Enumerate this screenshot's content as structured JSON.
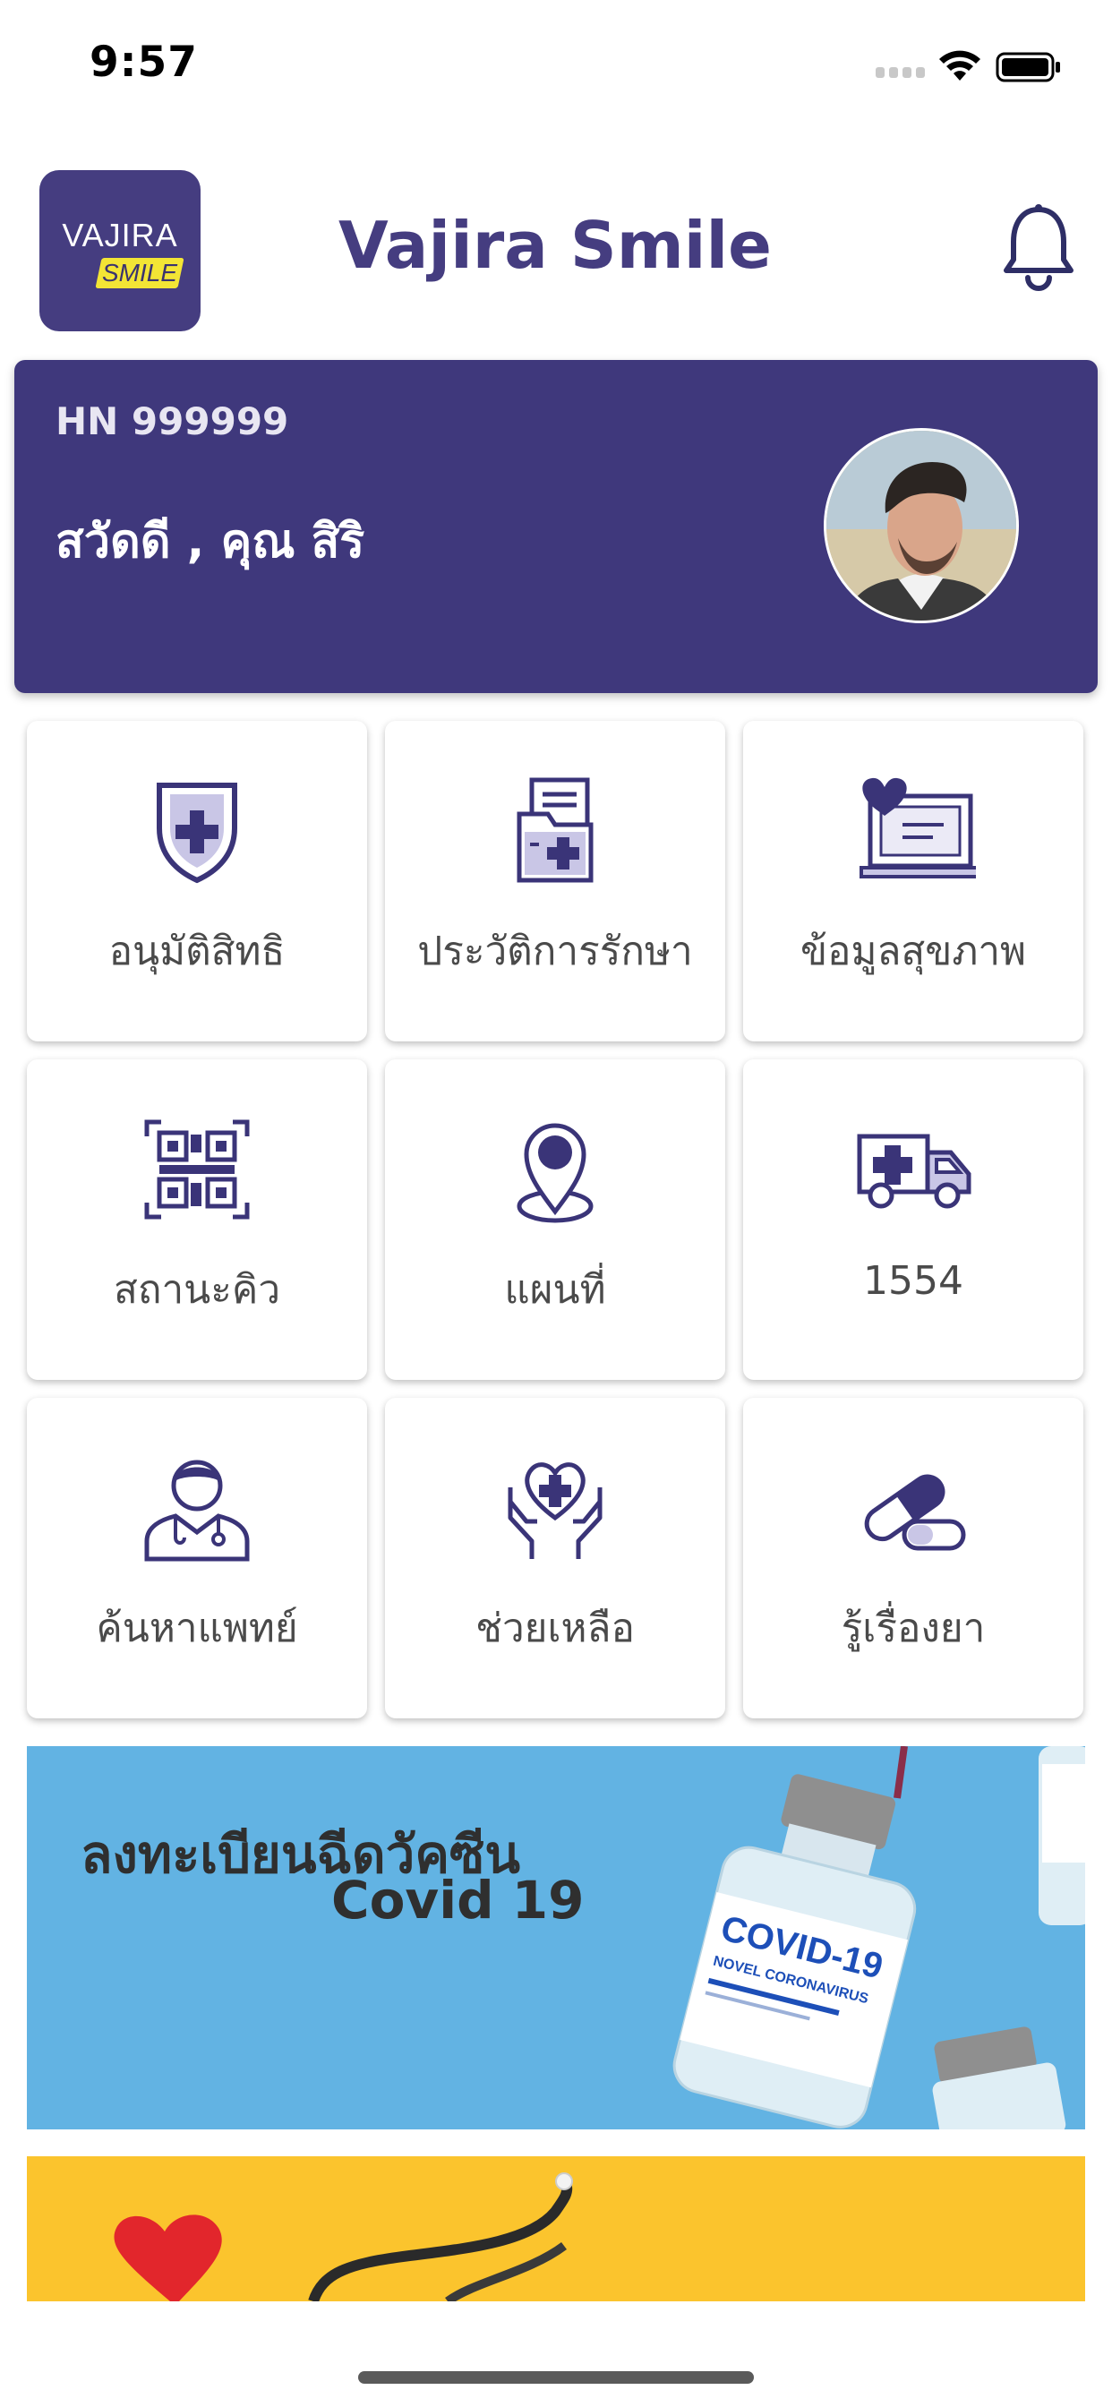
{
  "status_bar": {
    "time": "9:57"
  },
  "header": {
    "logo_top": "VAJIRA",
    "logo_badge": "SMILE",
    "title": "Vajira Smile"
  },
  "profile": {
    "hn": "HN 999999",
    "greeting": "สวัดดี , คุณ สิริ"
  },
  "menu": {
    "items": [
      {
        "label": "อนุมัติสิทธิ",
        "icon": "shield-plus-icon"
      },
      {
        "label": "ประวัติการรักษา",
        "icon": "medical-folder-icon"
      },
      {
        "label": "ข้อมูลสุขภาพ",
        "icon": "health-monitor-icon"
      },
      {
        "label": "สถานะคิว",
        "icon": "qr-code-icon"
      },
      {
        "label": "แผนที่",
        "icon": "map-pin-icon"
      },
      {
        "label": "1554",
        "icon": "ambulance-icon"
      },
      {
        "label": "ค้นหาแพทย์",
        "icon": "doctor-icon"
      },
      {
        "label": "ช่วยเหลือ",
        "icon": "heart-hands-icon"
      },
      {
        "label": "รู้เรื่องยา",
        "icon": "capsule-icon"
      }
    ]
  },
  "banners": {
    "vaccine_line1": "ลงทะเบียนฉีดวัคซีน",
    "vaccine_line2": "Covid 19",
    "vial_label": "COVID-19",
    "vial_sub": "NOVEL CORONAVIRUS"
  },
  "colors": {
    "brand": "#453d80",
    "card": "#3f387c",
    "banner_blue": "#62b3e3",
    "banner_yellow": "#fbc42d"
  }
}
